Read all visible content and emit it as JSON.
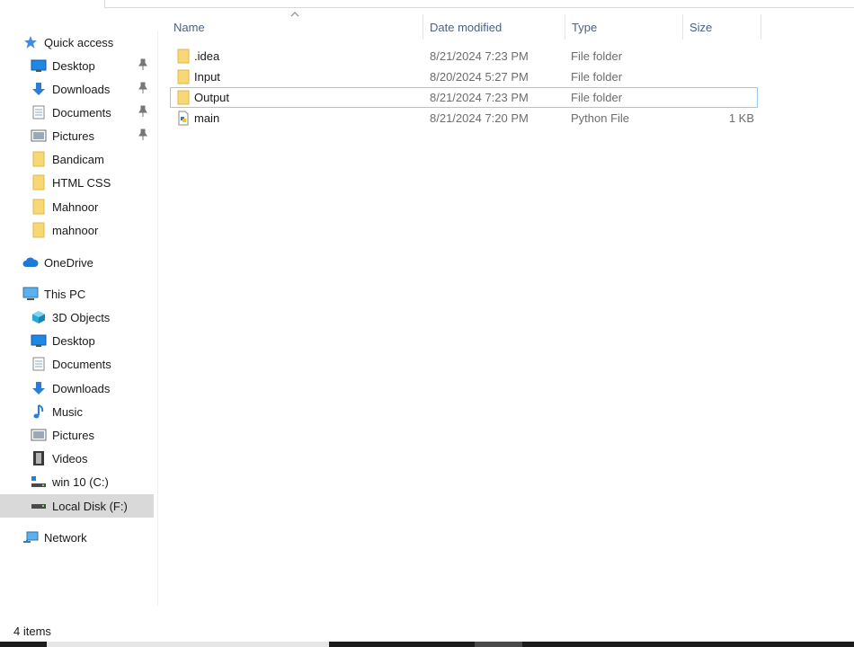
{
  "sidebar": {
    "quick_access": "Quick access",
    "quick_items": [
      {
        "label": "Desktop"
      },
      {
        "label": "Downloads"
      },
      {
        "label": "Documents"
      },
      {
        "label": "Pictures"
      },
      {
        "label": "Bandicam"
      },
      {
        "label": "HTML CSS"
      },
      {
        "label": "Mahnoor"
      },
      {
        "label": "mahnoor"
      }
    ],
    "onedrive": "OneDrive",
    "this_pc": "This PC",
    "pc_items": [
      {
        "label": "3D Objects"
      },
      {
        "label": "Desktop"
      },
      {
        "label": "Documents"
      },
      {
        "label": "Downloads"
      },
      {
        "label": "Music"
      },
      {
        "label": "Pictures"
      },
      {
        "label": "Videos"
      },
      {
        "label": "win 10 (C:)"
      },
      {
        "label": "Local Disk (F:)"
      }
    ],
    "network": "Network"
  },
  "columns": {
    "name": "Name",
    "date": "Date modified",
    "type": "Type",
    "size": "Size"
  },
  "files": [
    {
      "name": ".idea",
      "date": "8/21/2024 7:23 PM",
      "type": "File folder",
      "size": ""
    },
    {
      "name": "Input",
      "date": "8/20/2024 5:27 PM",
      "type": "File folder",
      "size": ""
    },
    {
      "name": "Output",
      "date": "8/21/2024 7:23 PM",
      "type": "File folder",
      "size": ""
    },
    {
      "name": "main",
      "date": "8/21/2024 7:20 PM",
      "type": "Python File",
      "size": "1 KB"
    }
  ],
  "status": {
    "item_count": "4 items"
  },
  "colors": {
    "selected_nav": "#d9d9d9",
    "focus_border": "#99c9ef",
    "header_text": "#4d6082",
    "folder_yellow": "#f8d775"
  }
}
